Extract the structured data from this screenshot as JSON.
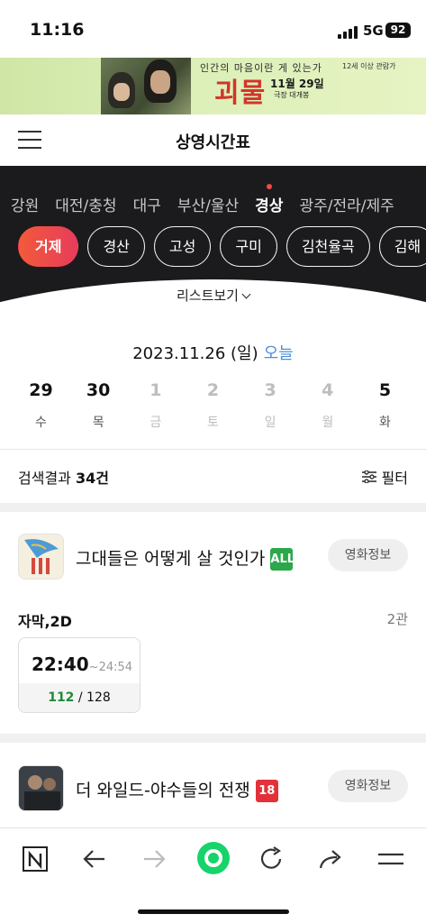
{
  "status": {
    "time": "11:16",
    "network": "5G",
    "battery": "92"
  },
  "banner": {
    "tagline": "인간의 마음이란 게 있는가",
    "age": "12세 이상 관람가",
    "title": "괴물",
    "release_date": "11월 29일",
    "release_note": "극장 대개봉"
  },
  "header": {
    "title": "상영시간표"
  },
  "regions": [
    "강원",
    "대전/충청",
    "대구",
    "부산/울산",
    "경상",
    "광주/전라/제주"
  ],
  "active_region": "경상",
  "theaters": [
    "거제",
    "경산",
    "고성",
    "구미",
    "김천율곡",
    "김해"
  ],
  "active_theater": "거제",
  "list_view_label": "리스트보기",
  "date": {
    "label": "2023.11.26 (일)",
    "today_label": "오늘"
  },
  "days": [
    {
      "num": "29",
      "weekday": "수",
      "available": true
    },
    {
      "num": "30",
      "weekday": "목",
      "available": true
    },
    {
      "num": "1",
      "weekday": "금",
      "available": false
    },
    {
      "num": "2",
      "weekday": "토",
      "available": false
    },
    {
      "num": "3",
      "weekday": "일",
      "available": false
    },
    {
      "num": "4",
      "weekday": "월",
      "available": false
    },
    {
      "num": "5",
      "weekday": "화",
      "available": true
    }
  ],
  "results": {
    "prefix": "검색결과 ",
    "count": "34건",
    "filter_label": "필터"
  },
  "movies": [
    {
      "title": "그대들은 어떻게 살 것인가",
      "rating": "ALL",
      "rating_color": "#2aa84a",
      "info_label": "영화정보",
      "format": "자막,2D",
      "hall": "2관",
      "showtime": {
        "start": "22:40",
        "end": "~24:54",
        "available": "112",
        "total": "/ 128"
      }
    },
    {
      "title": "더 와일드-야수들의 전쟁",
      "rating": "18",
      "rating_color": "#e3313a",
      "info_label": "영화정보"
    }
  ],
  "bottom_nav": [
    "n-logo-icon",
    "back-arrow-icon",
    "forward-arrow-icon",
    "green-dot-home-icon",
    "refresh-icon",
    "share-icon",
    "menu-icon"
  ]
}
